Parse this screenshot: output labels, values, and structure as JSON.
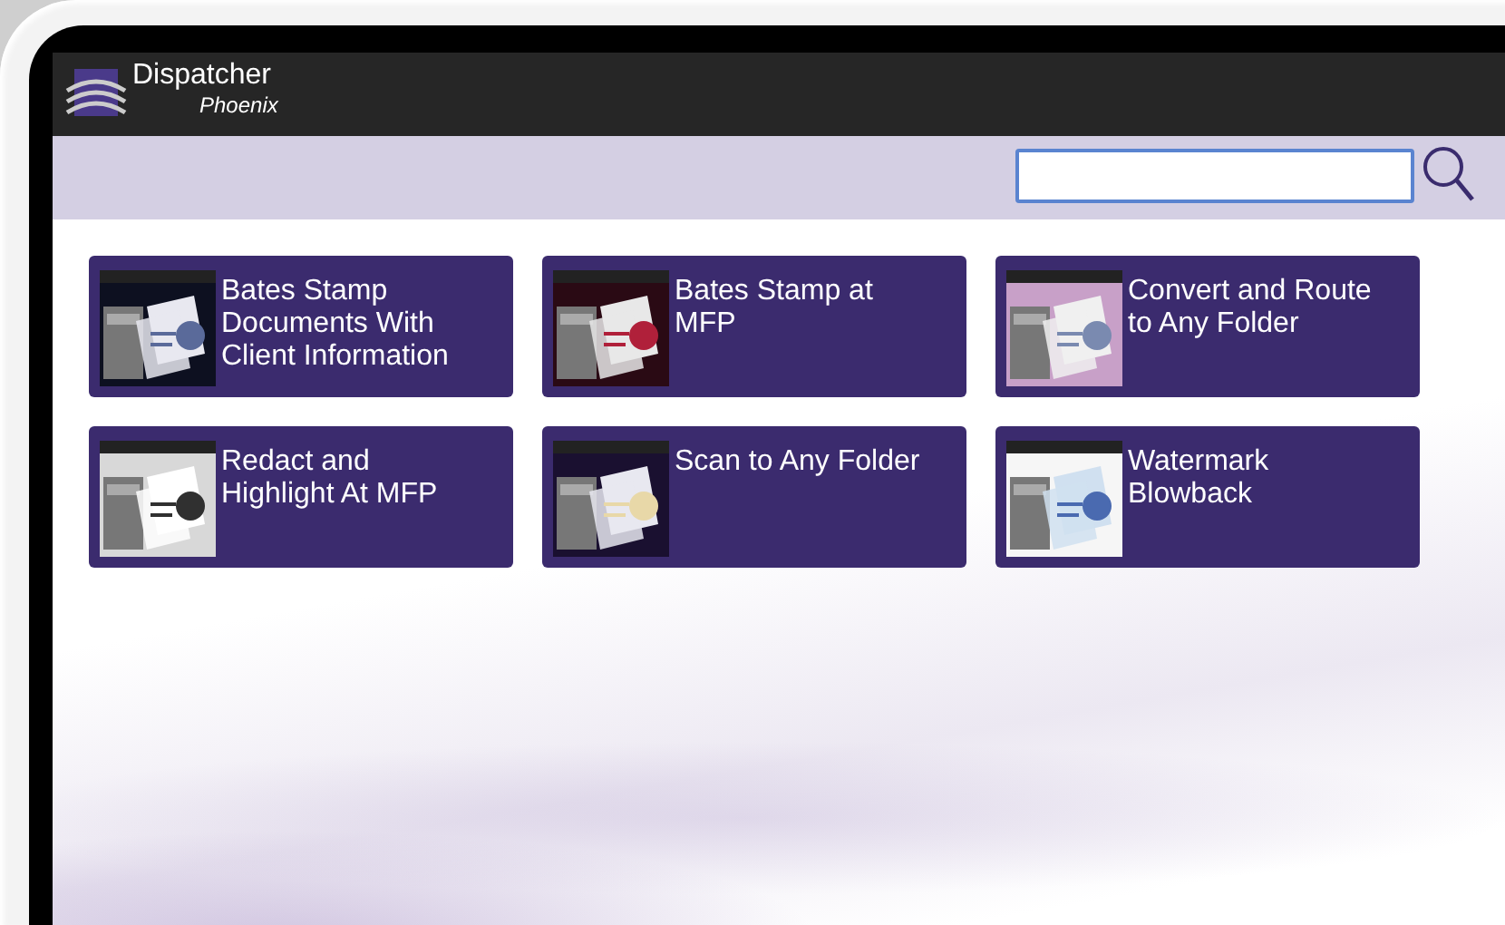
{
  "app": {
    "title": "Dispatcher",
    "subtitle": "Phoenix"
  },
  "tiles": [
    {
      "title": "Bates Stamp Documents With Client Information",
      "kind": "picture"
    },
    {
      "title": "Bates Stamp at MFP",
      "kind": "picture"
    },
    {
      "title": "Convert and Route to Any Folder",
      "kind": "picture"
    },
    {
      "title": "Redact and Highlight At MFP",
      "kind": "picture"
    },
    {
      "title": "Scan to Any Folder",
      "kind": "picture"
    },
    {
      "title": "Watermark Blowback",
      "kind": "picture"
    }
  ]
}
